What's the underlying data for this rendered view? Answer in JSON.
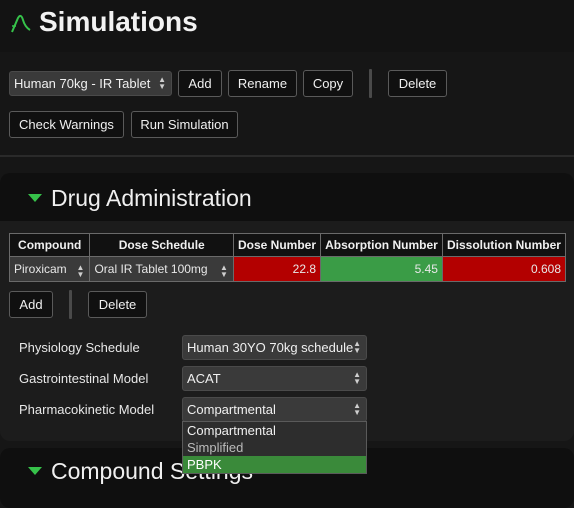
{
  "header": {
    "title": "Simulations",
    "logo_icon": "curve-logo-icon"
  },
  "toolbar": {
    "simulation_select": "Human 70kg - IR Tablet",
    "add": "Add",
    "rename": "Rename",
    "copy": "Copy",
    "delete": "Delete",
    "check_warnings": "Check Warnings",
    "run_simulation": "Run Simulation"
  },
  "drug_admin": {
    "title": "Drug Administration",
    "columns": [
      "Compound",
      "Dose Schedule",
      "Dose Number",
      "Absorption Number",
      "Dissolution Number"
    ],
    "rows": [
      {
        "compound": "Piroxicam",
        "dose_schedule": "Oral IR Tablet 100mg",
        "dose_number": "22.8",
        "absorption_number": "5.45",
        "dissolution_number": "0.608"
      }
    ],
    "status_colors": {
      "dose_number": "#b30000",
      "absorption_number": "#3a9c46",
      "dissolution_number": "#b30000"
    },
    "add": "Add",
    "delete": "Delete",
    "fields": {
      "physiology_label": "Physiology Schedule",
      "physiology_value": "Human 30YO 70kg schedule",
      "gi_label": "Gastrointestinal Model",
      "gi_value": "ACAT",
      "pk_label": "Pharmacokinetic Model",
      "pk_value": "Compartmental"
    },
    "pk_options": [
      "Compartmental",
      "Simplified",
      "PBPK"
    ],
    "pk_highlighted": "PBPK"
  },
  "compound_settings": {
    "title": "Compound Settings"
  },
  "colors": {
    "accent": "#36c24a",
    "background": "#161616"
  }
}
